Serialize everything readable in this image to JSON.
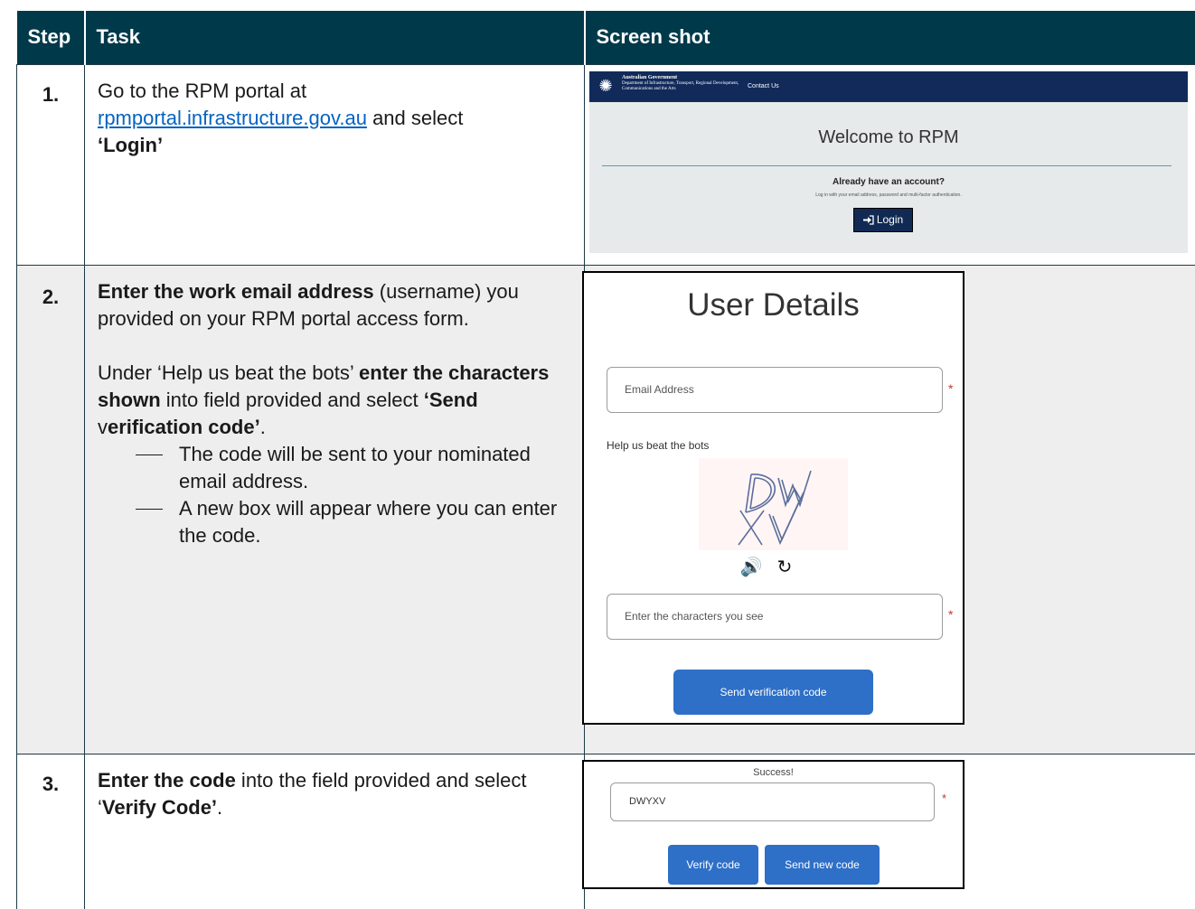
{
  "table": {
    "headers": {
      "step": "Step",
      "task": "Task",
      "screenshot": "Screen shot"
    }
  },
  "steps": [
    {
      "number": "1.",
      "task": {
        "line1": "Go to the RPM portal at",
        "link": "rpmportal.infrastructure.gov.au",
        "after_link": " and select ",
        "bold": "‘Login’"
      },
      "screenshot": {
        "org_title": "Australian Government",
        "org_dept": "Department of Infrastructure, Transport, Regional Development, Communications and the Arts",
        "nav_contact": "Contact Us",
        "welcome": "Welcome to RPM",
        "already_account": "Already have an account?",
        "login_instructions": "Log in with your email address, password and multi-factor authentication.",
        "login_button": "Login"
      }
    },
    {
      "number": "2.",
      "task": {
        "p1_bold": "Enter the work email address",
        "p1_rest": " (username) you provided on your RPM portal access form.",
        "p2_start": "Under ‘Help us beat the bots’ ",
        "p2_bold1": "enter the characters shown",
        "p2_mid": " into field provided and select ",
        "p2_bold2a": "‘Send ",
        "p2_v": "v",
        "p2_bold2b": "erification code’",
        "p2_end": ".",
        "bullets": [
          "The code will be sent to your nominated email address.",
          "A new box will appear where you can enter the code."
        ]
      },
      "screenshot": {
        "title": "User Details",
        "email_placeholder": "Email Address",
        "required_mark": "*",
        "captcha_label": "Help us beat the bots",
        "captcha_text": "DWXV",
        "characters_placeholder": "Enter the characters you see",
        "send_button": "Send verification code"
      }
    },
    {
      "number": "3.",
      "task": {
        "bold1": "Enter the code",
        "mid": " into the field provided and select ‘",
        "bold2": "Verify Code’",
        "end": "."
      },
      "screenshot": {
        "success": "Success!",
        "code_value": "DWYXV",
        "required_mark": "*",
        "verify_button": "Verify code",
        "new_code_button": "Send new code"
      }
    }
  ]
}
